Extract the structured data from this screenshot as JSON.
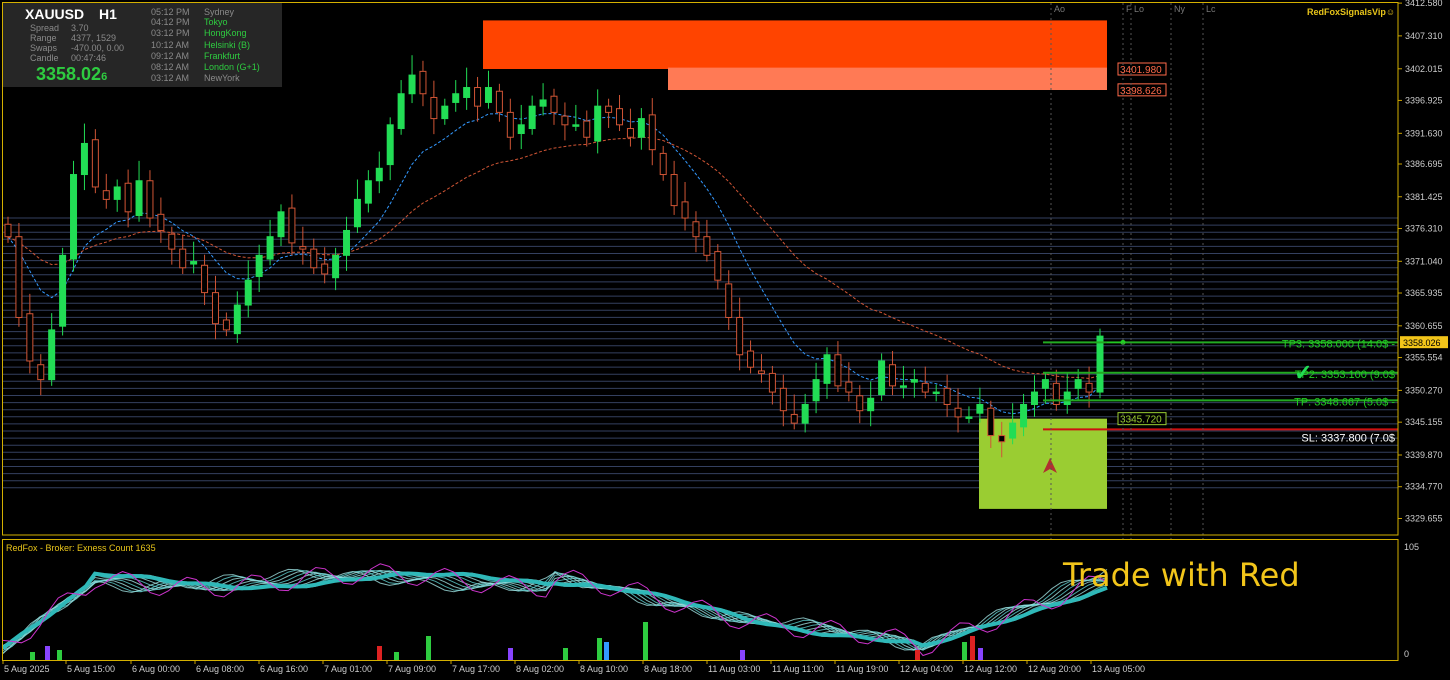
{
  "symbol_panel": {
    "symbol": "XAUUSD",
    "timeframe": "H1",
    "stats": [
      {
        "label": "Spread",
        "value": "3.70"
      },
      {
        "label": "Range",
        "value": "4377, 1529"
      },
      {
        "label": "Swaps",
        "value": "-470.00, 0.00"
      },
      {
        "label": "Candle",
        "value": "00:47:46"
      }
    ],
    "price_main": "3358.02",
    "price_tail": "6",
    "sessions": [
      {
        "time": "05:12 PM",
        "city": "Sydney",
        "color": "#8a8a8a"
      },
      {
        "time": "04:12 PM",
        "city": "Tokyo",
        "color": "#2ecc40"
      },
      {
        "time": "03:12 PM",
        "city": "HongKong",
        "color": "#2ecc40"
      },
      {
        "time": "10:12 AM",
        "city": "Helsinki  (B)",
        "color": "#2ecc40"
      },
      {
        "time": "09:12 AM",
        "city": "Frankfurt",
        "color": "#2ecc40"
      },
      {
        "time": "08:12 AM",
        "city": "London  (G+1)",
        "color": "#2ecc40"
      },
      {
        "time": "03:12 AM",
        "city": "NewYork",
        "color": "#8a8a8a"
      }
    ]
  },
  "branding": {
    "label": "RedFoxSignalsVip",
    "icon": "smiley-icon"
  },
  "session_markers": [
    "Ao",
    "F",
    "Lo",
    "Ny",
    "Lc"
  ],
  "overlay_text": "Trade with Red",
  "subwindow_header": "RedFox -  Broker: Exness    Count  1635",
  "colors": {
    "bull": "#22dd55",
    "bear": "#d05535",
    "supply_zone": "#ff4400",
    "supply_zone_light": "#ff7a55",
    "demand_zone": "#9acd32",
    "tp_line": "#22aa22",
    "sl_line": "#cc1111",
    "ma_fast": "#3399ff",
    "ma_slow": "#d05535",
    "axis_text": "#cccccc",
    "price_tag": "#f2c51a"
  },
  "chart_data": [
    {
      "type": "candlestick",
      "title": "XAUUSD H1",
      "ylim": [
        3327.0,
        3412.6
      ],
      "y_ticks": [
        "3412.580",
        "3407.310",
        "3402.015",
        "3396.925",
        "3391.630",
        "3386.695",
        "3381.425",
        "3376.310",
        "3371.040",
        "3365.935",
        "3360.655",
        "3355.554",
        "3350.270",
        "3345.155",
        "3339.870",
        "3334.770",
        "3329.655"
      ],
      "x_ticks": [
        "5 Aug 2025",
        "5 Aug 15:00",
        "6 Aug 00:00",
        "6 Aug 08:00",
        "6 Aug 16:00",
        "7 Aug 01:00",
        "7 Aug 09:00",
        "7 Aug 17:00",
        "8 Aug 02:00",
        "8 Aug 10:00",
        "8 Aug 18:00",
        "11 Aug 03:00",
        "11 Aug 11:00",
        "11 Aug 19:00",
        "12 Aug 04:00",
        "12 Aug 12:00",
        "12 Aug 20:00",
        "13 Aug 05:00"
      ],
      "current_price": "3358.026",
      "close_path": [
        3375,
        3362,
        3355,
        3352,
        3360,
        3372,
        3385,
        3390,
        3383,
        3381,
        3383,
        3379,
        3384,
        3378,
        3376,
        3373,
        3370,
        3371,
        3366,
        3361,
        3360,
        3364,
        3368,
        3372,
        3375,
        3379,
        3374,
        3373,
        3370,
        3369,
        3372,
        3376,
        3381,
        3384,
        3386,
        3393,
        3398,
        3401,
        3398,
        3394,
        3396,
        3398,
        3399,
        3396,
        3399,
        3395,
        3391,
        3393,
        3396,
        3397,
        3395,
        3393,
        3393,
        3391,
        3396,
        3395,
        3393,
        3391,
        3394,
        3389,
        3385,
        3380,
        3378,
        3375,
        3372,
        3368,
        3362,
        3356,
        3354,
        3353,
        3350,
        3347,
        3345,
        3348,
        3352,
        3356,
        3351,
        3350,
        3347,
        3349,
        3355,
        3351,
        3351,
        3352,
        3350,
        3350,
        3348,
        3346,
        3346,
        3348,
        3343,
        3342,
        3345,
        3348,
        3350,
        3352,
        3348,
        3350,
        3352,
        3350,
        3359
      ],
      "lines": [
        {
          "name": "TP3",
          "label": "TP3: 3358.000 (14.0$ -",
          "value": 3358.0,
          "color": "#22aa22"
        },
        {
          "name": "TP2",
          "label": "TP2: 3353.100 (9.0$",
          "value": 3353.1,
          "color": "#22aa22"
        },
        {
          "name": "TP",
          "label": "TP: 3348.667 (5.0$ -",
          "value": 3348.667,
          "color": "#22aa22"
        },
        {
          "name": "SL",
          "label": "SL: 3337.800 (7.0$",
          "value": 3344.0,
          "color": "#cc1111"
        }
      ],
      "zones": [
        {
          "label": "",
          "from": 3401.98,
          "to": 3409.8,
          "color": "#ff4400"
        },
        {
          "label": "3401.980",
          "value": 3401.98,
          "from": 3398.6,
          "to": 3402.2,
          "color": "#ff7a55"
        },
        {
          "label": "3398.626",
          "value": 3398.626
        },
        {
          "label": "3345.720",
          "value": 3345.72,
          "from": 3331.2,
          "to": 3345.72,
          "color": "#9acd32"
        }
      ],
      "moving_averages": [
        "fast",
        "slow"
      ]
    },
    {
      "type": "line",
      "title": "RedFox -  Broker: Exness    Count  1635",
      "ylim": [
        0,
        105
      ],
      "y_ticks": [
        "105",
        "0"
      ],
      "series_note": "ribbon of smoothed oscillator lines plus histogram"
    }
  ]
}
